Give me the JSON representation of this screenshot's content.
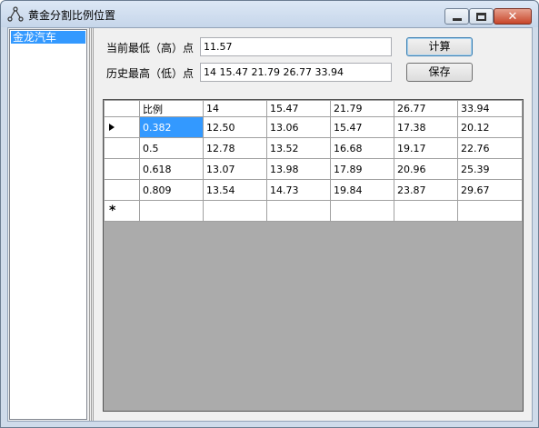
{
  "window": {
    "title": "黄金分割比例位置"
  },
  "listbox": {
    "items": [
      "金龙汽车"
    ]
  },
  "form": {
    "current_label": "当前最低（高）点",
    "current_value": "11.57",
    "history_label": "历史最高（低）点",
    "history_value": "14 15.47 21.79 26.77 33.94",
    "calc_button": "计算",
    "save_button": "保存"
  },
  "grid": {
    "columns": [
      "比例",
      "14",
      "15.47",
      "21.79",
      "26.77",
      "33.94"
    ],
    "rows": [
      [
        "0.382",
        "12.50",
        "13.06",
        "15.47",
        "17.38",
        "20.12"
      ],
      [
        "0.5",
        "12.78",
        "13.52",
        "16.68",
        "19.17",
        "22.76"
      ],
      [
        "0.618",
        "13.07",
        "13.98",
        "17.89",
        "20.96",
        "25.39"
      ],
      [
        "0.809",
        "13.54",
        "14.73",
        "19.84",
        "23.87",
        "29.67"
      ]
    ],
    "new_row_marker": "*"
  }
}
